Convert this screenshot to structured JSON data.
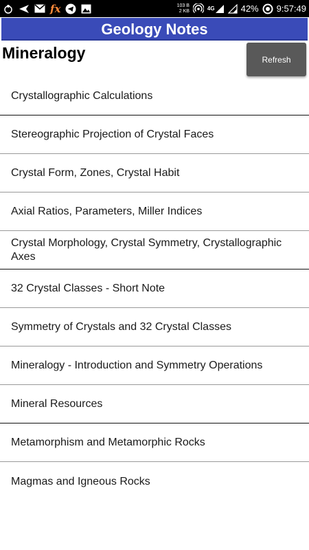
{
  "status_bar": {
    "net_speed_value": "103 B",
    "net_speed_unit": "2 KB",
    "network_type": "4G",
    "battery_percent": "42%",
    "time": "9:57:49",
    "left_icons": [
      "app-icon",
      "send-icon",
      "mail-icon",
      "fx-icon",
      "telegram-icon",
      "image-icon"
    ]
  },
  "app_bar": {
    "title": "Geology Notes",
    "color": "#3a4bb8"
  },
  "header": {
    "section_title": "Mineralogy",
    "refresh_label": "Refresh"
  },
  "list": {
    "items": [
      {
        "label": "Crystallographic Calculations"
      },
      {
        "label": "Stereographic Projection of Crystal Faces"
      },
      {
        "label": "Crystal Form, Zones, Crystal Habit"
      },
      {
        "label": "Axial Ratios, Parameters, Miller Indices"
      },
      {
        "label": "Crystal Morphology, Crystal Symmetry, Crystallographic Axes"
      },
      {
        "label": "32 Crystal Classes - Short Note"
      },
      {
        "label": "Symmetry of Crystals and 32 Crystal Classes"
      },
      {
        "label": "Mineralogy - Introduction and Symmetry Operations"
      },
      {
        "label": "Mineral Resources"
      },
      {
        "label": "Metamorphism and Metamorphic Rocks"
      },
      {
        "label": "Magmas and Igneous Rocks"
      }
    ]
  }
}
